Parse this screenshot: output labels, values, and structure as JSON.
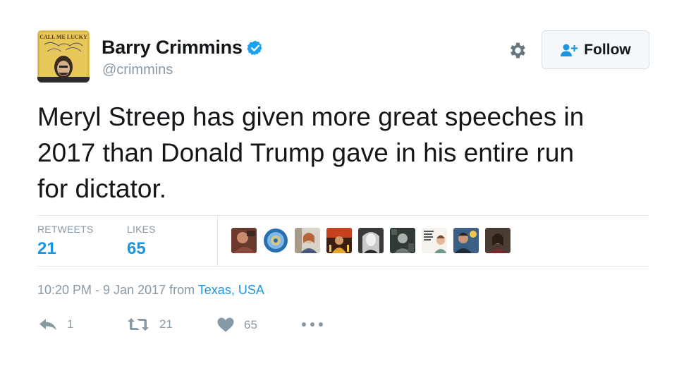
{
  "user": {
    "name": "Barry Crimmins",
    "handle": "@crimmins",
    "avatar_text": "CALL ME LUCKY"
  },
  "follow": {
    "label": "Follow"
  },
  "tweet": {
    "lines": [
      "Meryl Streep has given more great speeches in",
      "2017 than Donald Trump gave in his entire run",
      "for dictator."
    ]
  },
  "stats": {
    "retweets_label": "RETWEETS",
    "retweets_value": "21",
    "likes_label": "LIKES",
    "likes_value": "65"
  },
  "meta": {
    "time": "10:20 PM - 9 Jan 2017 from ",
    "location": "Texas, USA"
  },
  "actions": {
    "reply_count": "1",
    "retweet_count": "21",
    "like_count": "65"
  },
  "colors": {
    "accent": "#1b95e0",
    "muted": "#8899a6",
    "border": "#e1e8ed"
  },
  "icons": [
    "verified-badge-icon",
    "gear-icon",
    "follow-person-icon",
    "reply-icon",
    "retweet-icon",
    "heart-icon",
    "more-icon"
  ]
}
